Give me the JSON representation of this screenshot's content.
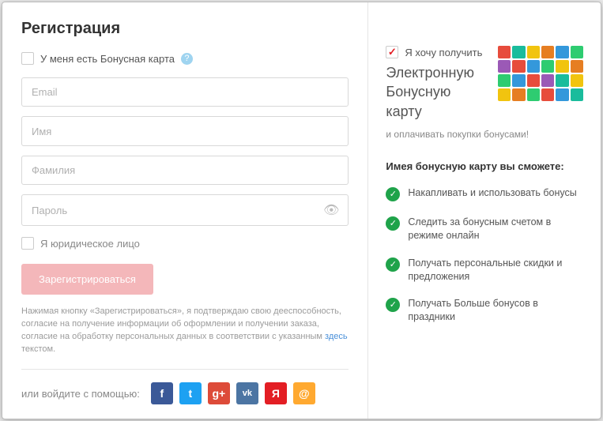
{
  "left": {
    "title": "Регистрация",
    "have_card_label": "У меня есть Бонусная карта",
    "fields": {
      "email": "Email",
      "name": "Имя",
      "surname": "Фамилия",
      "password": "Пароль"
    },
    "juridical_label": "Я юридическое лицо",
    "submit_label": "Зарегистрироваться",
    "legal_prefix": "Нажимая кнопку «Зарегистрироваться», я подтверждаю свою дееспособность, согласие на получение информации об оформлении и получении заказа, согласие на обработку персональных данных в соответствии с указанным ",
    "legal_link": "здесь",
    "legal_suffix": " текстом.",
    "social_prompt": "или войдите с помощью:"
  },
  "right": {
    "wish_label": "Я хочу получить",
    "promo_title": "Электронную Бонусную карту",
    "promo_sub": "и оплачивать покупки бонусами!",
    "benefits_head": "Имея бонусную карту вы сможете:",
    "benefits": [
      "Накапливать и использовать бонусы",
      "Следить за бонусным счетом в режиме онлайн",
      "Получать персональные скидки и предложения",
      "Получать Больше бонусов в праздники"
    ]
  },
  "social": {
    "fb": "f",
    "tw": "t",
    "gp": "g+",
    "vk": "vk",
    "ya": "Я",
    "ml": "@"
  },
  "mosaic_colors": [
    "#e74c3c",
    "#1abc9c",
    "#f1c40f",
    "#e67e22",
    "#3498db",
    "#2ecc71",
    "#9b59b6",
    "#e74c3c",
    "#3498db",
    "#2ecc71",
    "#f1c40f",
    "#e67e22",
    "#2ecc71",
    "#3498db",
    "#e74c3c",
    "#9b59b6",
    "#1abc9c",
    "#f1c40f",
    "#f1c40f",
    "#e67e22",
    "#2ecc71",
    "#e74c3c",
    "#3498db",
    "#1abc9c"
  ]
}
